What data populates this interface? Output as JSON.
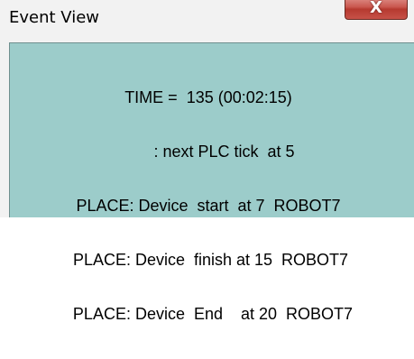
{
  "window": {
    "title": "Event View"
  },
  "controls": {
    "close_icon": "close-x-icon",
    "close_glyph": "X",
    "close_color": "#c9574e"
  },
  "content": {
    "background": "#9cccca",
    "lines": [
      "TIME =  135 (00:02:15)",
      "       : next PLC tick  at 5",
      "PLACE: Device  start  at 7  ROBOT7",
      " PLACE: Device  finish at 15  ROBOT7",
      "  PLACE: Device  End    at 20  ROBOT7"
    ]
  }
}
